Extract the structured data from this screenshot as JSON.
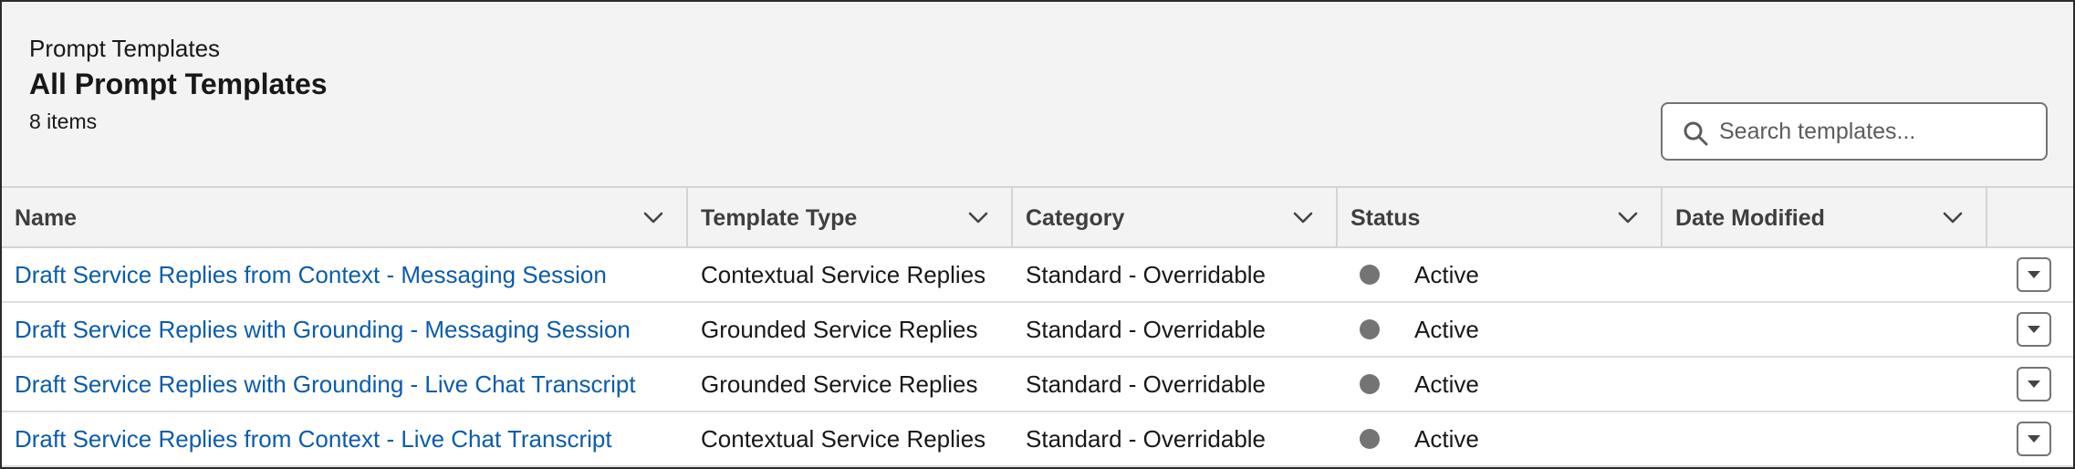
{
  "header": {
    "eyebrow": "Prompt Templates",
    "title": "All Prompt Templates",
    "count": "8 items"
  },
  "search": {
    "placeholder": "Search templates...",
    "value": "",
    "icon": "search-icon"
  },
  "table": {
    "columns": [
      {
        "key": "name",
        "label": "Name"
      },
      {
        "key": "type",
        "label": "Template Type"
      },
      {
        "key": "category",
        "label": "Category"
      },
      {
        "key": "status",
        "label": "Status"
      },
      {
        "key": "date",
        "label": "Date Modified"
      }
    ],
    "rows": [
      {
        "name": "Draft Service Replies from Context - Messaging Session",
        "type": "Contextual Service Replies",
        "category": "Standard - Overridable",
        "status": "Active",
        "date": ""
      },
      {
        "name": "Draft Service Replies with Grounding - Messaging Session",
        "type": "Grounded Service Replies",
        "category": "Standard - Overridable",
        "status": "Active",
        "date": ""
      },
      {
        "name": "Draft Service Replies with Grounding - Live Chat Transcript",
        "type": "Grounded Service Replies",
        "category": "Standard - Overridable",
        "status": "Active",
        "date": ""
      },
      {
        "name": "Draft Service Replies from Context - Live Chat Transcript",
        "type": "Contextual Service Replies",
        "category": "Standard - Overridable",
        "status": "Active",
        "date": ""
      }
    ]
  },
  "colors": {
    "link": "#0b5cab",
    "header_bg": "#f3f3f3",
    "status_dot": "#747474",
    "border": "#d4d4d4"
  }
}
